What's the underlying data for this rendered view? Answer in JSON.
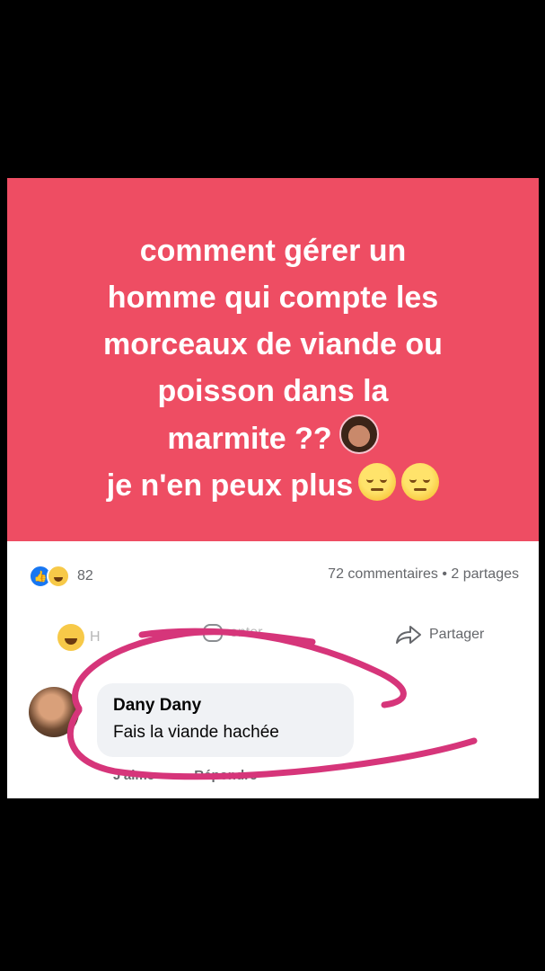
{
  "post": {
    "banner_lines": [
      "comment gérer un",
      "homme qui compte les",
      "morceaux de viande ou",
      "poisson dans la",
      "marmite ??",
      "je n'en peux plus"
    ],
    "banner_color": "#ee4d63"
  },
  "stats": {
    "reaction_count": "82",
    "comments_shares": "72 commentaires • 2 partages"
  },
  "actions": {
    "react_label": "H",
    "comment_label": "enter",
    "share_label": "Partager"
  },
  "comment": {
    "author": "Dany Dany",
    "text": "Fais la viande hachée",
    "meta_like": "J'aime",
    "meta_reply": "Répondre"
  },
  "annotation_color": "#d6357a"
}
